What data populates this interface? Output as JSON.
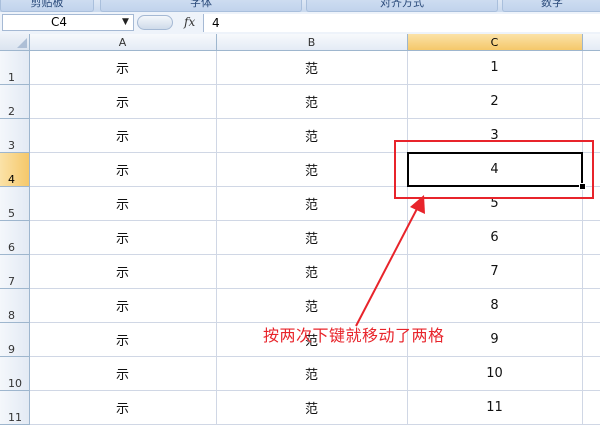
{
  "ribbon": {
    "groups": [
      "剪贴板",
      "字体",
      "对齐方式",
      "数字"
    ]
  },
  "formula_bar": {
    "name_box": "C4",
    "fx_label": "fx",
    "content": "4"
  },
  "columns": [
    "A",
    "B",
    "C"
  ],
  "active_column": "C",
  "active_row": 4,
  "rows": [
    {
      "num": "1",
      "a": "示",
      "b": "范",
      "c": "1"
    },
    {
      "num": "2",
      "a": "示",
      "b": "范",
      "c": "2"
    },
    {
      "num": "3",
      "a": "示",
      "b": "范",
      "c": "3"
    },
    {
      "num": "4",
      "a": "示",
      "b": "范",
      "c": "4"
    },
    {
      "num": "5",
      "a": "示",
      "b": "范",
      "c": "5"
    },
    {
      "num": "6",
      "a": "示",
      "b": "范",
      "c": "6"
    },
    {
      "num": "7",
      "a": "示",
      "b": "范",
      "c": "7"
    },
    {
      "num": "8",
      "a": "示",
      "b": "范",
      "c": "8"
    },
    {
      "num": "9",
      "a": "示",
      "b": "范",
      "c": "9"
    },
    {
      "num": "10",
      "a": "示",
      "b": "范",
      "c": "10"
    },
    {
      "num": "11",
      "a": "示",
      "b": "范",
      "c": "11"
    }
  ],
  "annotation": {
    "text": "按两次下键就移动了两格",
    "color": "#e8242b"
  },
  "colors": {
    "selection_border": "#000000",
    "header_active": "#f5c86a",
    "gridline": "#d0d7e5"
  }
}
